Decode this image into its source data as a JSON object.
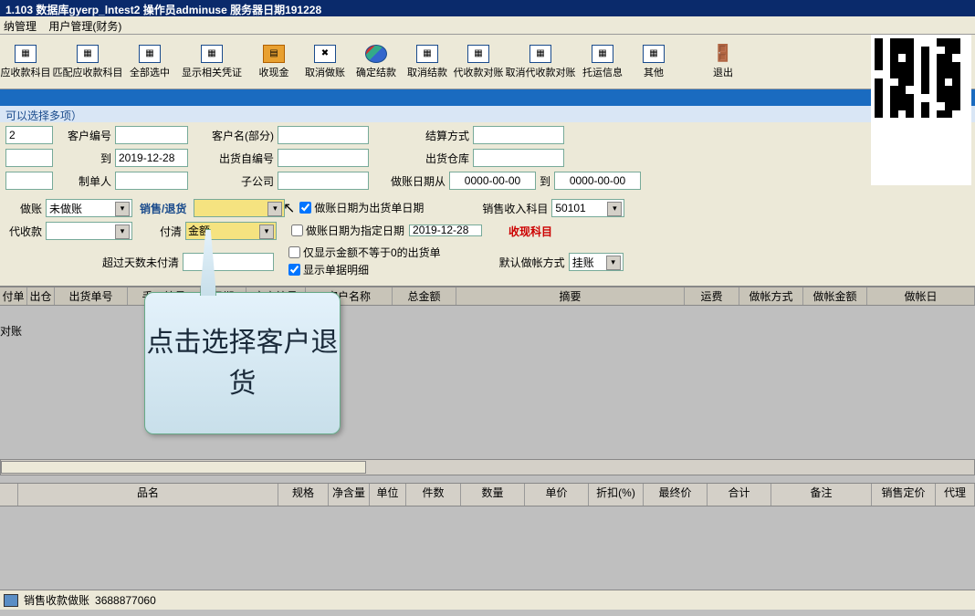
{
  "title": "1.103  数据库gyerp_lntest2  操作员adminuse  服务器日期191228",
  "menu": [
    "纳管理",
    "用户管理(财务)"
  ],
  "toolbar": [
    {
      "label": "应收款科目"
    },
    {
      "label": "匹配应收款科目"
    },
    {
      "label": "全部选中"
    },
    {
      "label": "显示相关凭证"
    },
    {
      "label": "收现金"
    },
    {
      "label": "取消做账"
    },
    {
      "label": "确定结款"
    },
    {
      "label": "取消结款"
    },
    {
      "label": "代收款对账"
    },
    {
      "label": "取消代收款对账"
    },
    {
      "label": "托运信息"
    },
    {
      "label": "其他"
    },
    {
      "label": "退出"
    }
  ],
  "hint": "可以选择多项）",
  "filters": {
    "row1": {
      "inp1": "2",
      "l_custno": "客户编号",
      "l_custname": "客户名(部分)",
      "l_method": "结算方式"
    },
    "row2": {
      "l_to": "到",
      "date": "2019-12-28",
      "l_shipno": "出货自编号",
      "l_warehouse": "出货仓库"
    },
    "row3": {
      "l_maker": "制单人",
      "l_sub": "子公司",
      "l_bookfrom": "做账日期从",
      "d1": "0000-00-00",
      "l_to2": "到",
      "d2": "0000-00-00"
    },
    "row4": {
      "l_book": "做账",
      "sel_book": "未做账",
      "l_salesreturn": "销售/退货",
      "cb1": "做账日期为出货单日期",
      "l_income": "销售收入科目",
      "income_val": "50101"
    },
    "row5": {
      "l_proxy": "代收款",
      "l_dz": "对账",
      "l_settle": "付清",
      "sel_settle": "金额",
      "cb2": "做账日期为指定日期",
      "d3": "2019-12-28",
      "l_cash": "收现科目"
    },
    "row6": {
      "l_overdue": "超过天数未付清",
      "cb3": "仅显示金额不等于0的出货单",
      "cb4": "显示单据明细",
      "l_default": "默认做帐方式",
      "default_val": "挂账"
    }
  },
  "grid1_headers": [
    "付单",
    "出仓",
    "出货单号",
    "手工编号",
    "日期",
    "客户编号",
    "客户名称",
    "总金额",
    "摘要",
    "运费",
    "做帐方式",
    "做帐金额",
    "做帐日"
  ],
  "grid2_headers": [
    "品名",
    "规格",
    "净含量",
    "单位",
    "件数",
    "数量",
    "单价",
    "折扣(%)",
    "最终价",
    "合计",
    "备注",
    "销售定价",
    "代理"
  ],
  "status": {
    "tab": "销售收款做账",
    "num": "3688877060"
  },
  "callout": "点击选择客户退货"
}
